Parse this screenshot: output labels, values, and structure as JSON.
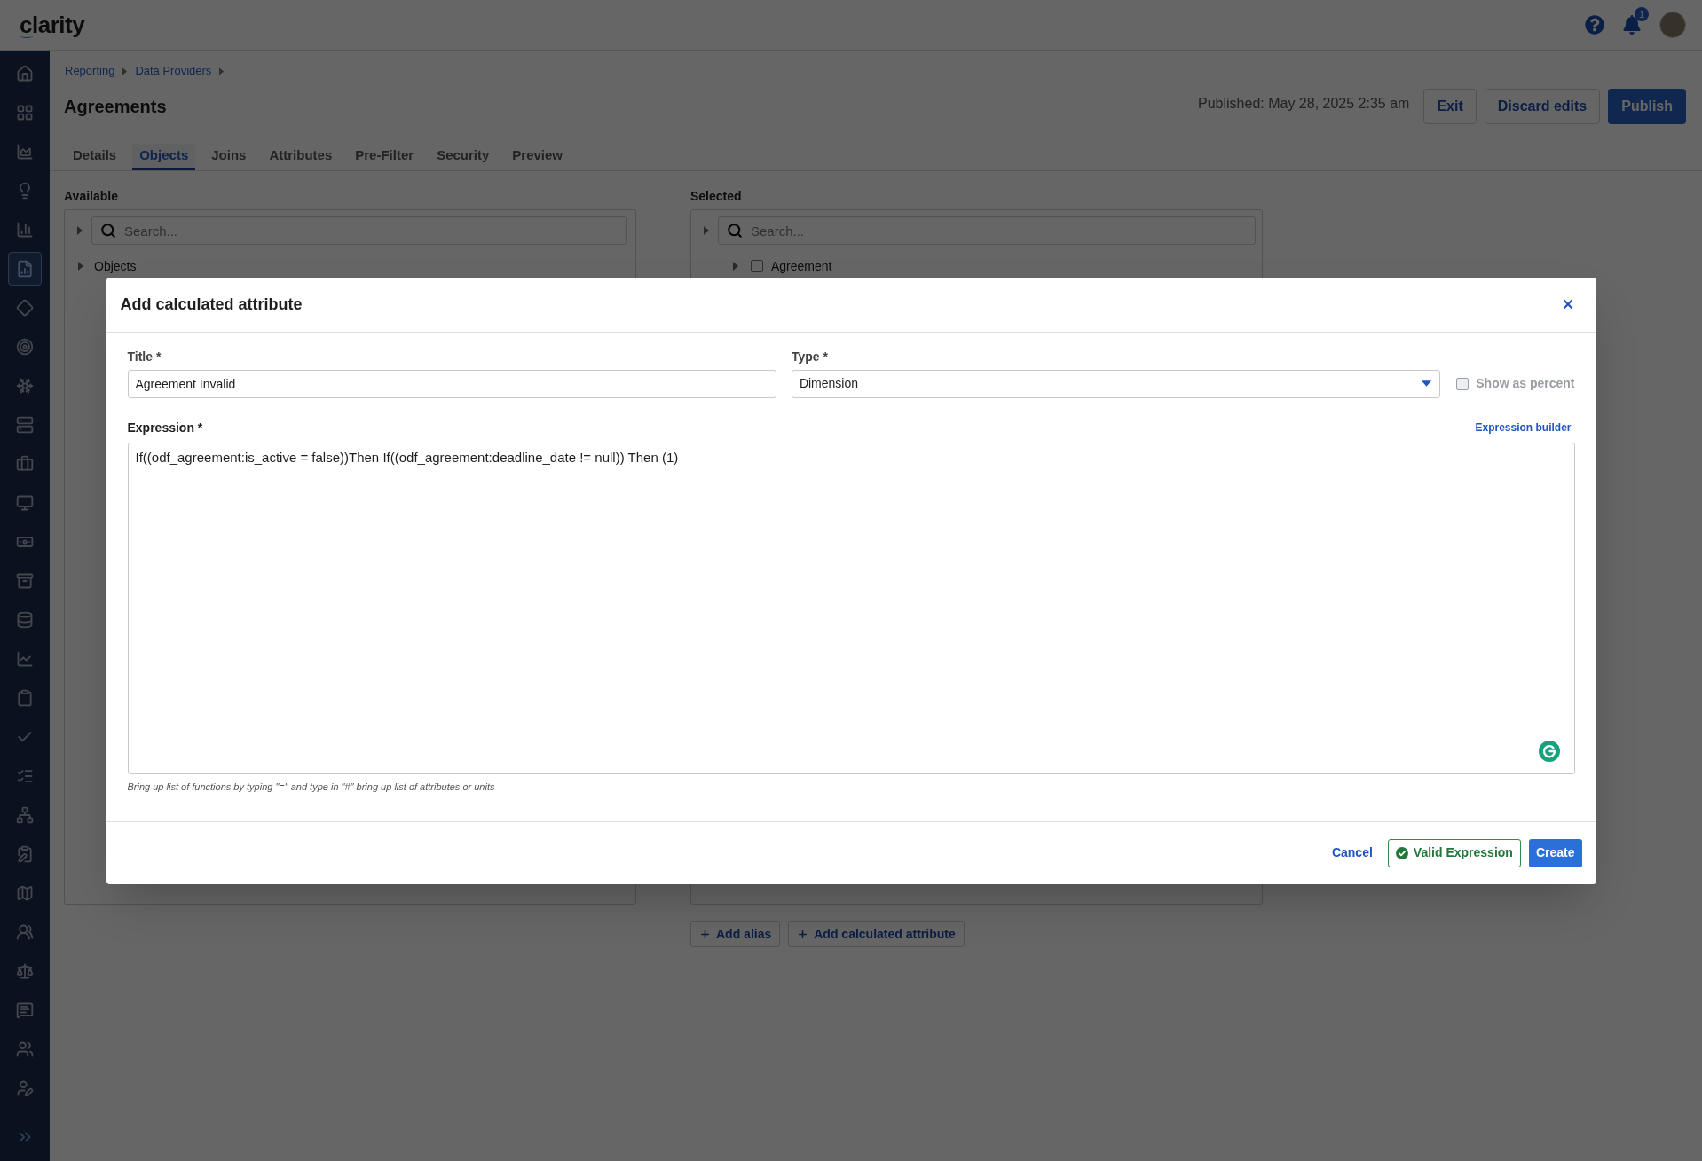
{
  "header": {
    "logo": "clarity",
    "notification_count": "1"
  },
  "sidebar": {
    "items": [
      {
        "selected": false
      },
      {
        "selected": false
      },
      {
        "selected": false
      },
      {
        "selected": false
      },
      {
        "selected": false
      },
      {
        "selected": true
      },
      {
        "selected": false
      },
      {
        "selected": false
      },
      {
        "selected": false
      },
      {
        "selected": false
      },
      {
        "selected": false
      },
      {
        "selected": false
      },
      {
        "selected": false
      },
      {
        "selected": false
      },
      {
        "selected": false
      },
      {
        "selected": false
      },
      {
        "selected": false
      },
      {
        "selected": false
      },
      {
        "selected": false
      },
      {
        "selected": false
      },
      {
        "selected": false
      },
      {
        "selected": false
      },
      {
        "selected": false
      },
      {
        "selected": false
      },
      {
        "selected": false
      },
      {
        "selected": false
      },
      {
        "selected": false
      }
    ]
  },
  "breadcrumbs": [
    "Reporting",
    "Data Providers"
  ],
  "page": {
    "title": "Agreements",
    "published": "Published: May 28, 2025 2:35 am",
    "buttons": [
      {
        "label": "Exit",
        "kind": "secondary"
      },
      {
        "label": "Discard edits",
        "kind": "secondary"
      },
      {
        "label": "Publish",
        "kind": "primary"
      }
    ]
  },
  "tabs": [
    {
      "label": "Details",
      "selected": false
    },
    {
      "label": "Objects",
      "selected": true
    },
    {
      "label": "Joins",
      "selected": false
    },
    {
      "label": "Attributes",
      "selected": false
    },
    {
      "label": "Pre-Filter",
      "selected": false
    },
    {
      "label": "Security",
      "selected": false
    },
    {
      "label": "Preview",
      "selected": false
    }
  ],
  "available": {
    "label": "Available",
    "search": {
      "placeholder": "Search..."
    },
    "tree": [
      {
        "label": "Objects",
        "expanded": false
      }
    ]
  },
  "selected": {
    "label": "Selected",
    "search": {
      "placeholder": "Search..."
    },
    "tree": [
      {
        "label": "Agreement",
        "expanded": false,
        "checked": false
      }
    ]
  },
  "actions": [
    "Add alias",
    "Add calculated attribute"
  ],
  "dialog": {
    "title": "Add calculated attribute",
    "title_field": {
      "label": "Title *",
      "value": "Agreement Invalid"
    },
    "type_field": {
      "label": "Type *",
      "value": "Dimension"
    },
    "show_as_percent": {
      "label": "Show as percent",
      "checked": false,
      "disabled": true
    },
    "expression": {
      "label": "Expression *",
      "link": "Expression builder",
      "value": "If((odf_agreement:is_active = false))Then If((odf_agreement:deadline_date != null)) Then (1)",
      "hint": "Bring up list of functions by typing \"=\" and type in \"#\" bring up list of attributes or units"
    },
    "footer": {
      "cancel": "Cancel",
      "validation": {
        "label": "Valid Expression",
        "valid": true
      },
      "create": "Create"
    }
  }
}
